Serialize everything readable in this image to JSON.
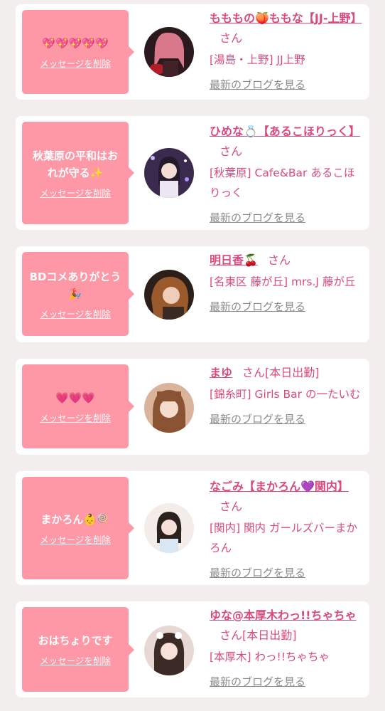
{
  "colors": {
    "accent": "#db4a7f",
    "bubble": "#fe98a7",
    "background": "#f2eeee",
    "link_gray": "#8a8a8a"
  },
  "common": {
    "delete_label": "メッセージを削除",
    "blog_label": "最新のブログを見る",
    "san": "さん"
  },
  "cards": [
    {
      "message": "💖💖💖💖💖",
      "name": "もももの🍑ももな【JJ-上野】",
      "status": "",
      "shop": "[湯島・上野] JJ上野"
    },
    {
      "message": "秋葉原の平和はおれが守る✨",
      "name": "ひめな💍【あるこほりっく】",
      "status": "",
      "shop": "[秋葉原] Cafe&Bar あるこほりっく"
    },
    {
      "message": "BDコメありがとう🎉",
      "name": "明日香🍒",
      "status": "",
      "shop": "[名東区 藤が丘] mrs.J 藤が丘"
    },
    {
      "message": "💗💗💗",
      "name": "まゆ",
      "status": "[本日出勤]",
      "shop": "[錦糸町] Girls Bar の一たいむ"
    },
    {
      "message": "まかろん👶🍭",
      "name": "なごみ【まかろん💜関内】",
      "status": "",
      "shop": "[関内] 関内 ガールズバーまかろん"
    },
    {
      "message": "おはちょりです",
      "name": "ゆな@本厚木わっ!!ちゃちゃ",
      "status": "[本日出勤]",
      "shop": "[本厚木] わっ!!ちゃちゃ"
    }
  ]
}
